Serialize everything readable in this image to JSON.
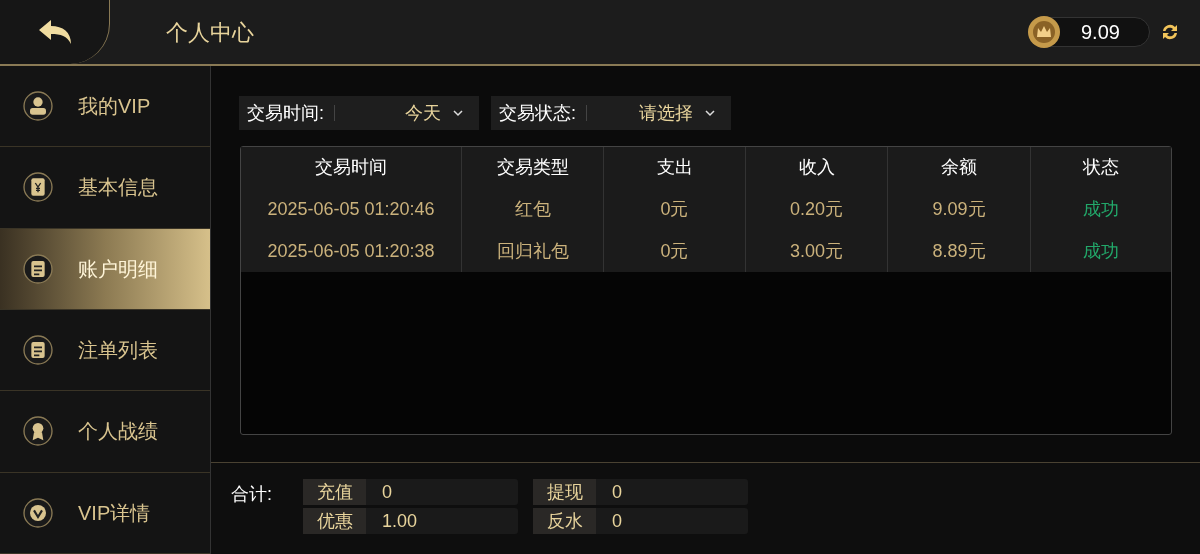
{
  "header": {
    "title": "个人中心",
    "balance": "9.09"
  },
  "sidebar": {
    "items": [
      {
        "label": "我的VIP",
        "selected": false
      },
      {
        "label": "基本信息",
        "selected": false
      },
      {
        "label": "账户明细",
        "selected": true
      },
      {
        "label": "注单列表",
        "selected": false
      },
      {
        "label": "个人战绩",
        "selected": false
      },
      {
        "label": "VIP详情",
        "selected": false
      }
    ]
  },
  "filters": [
    {
      "label": "交易时间:",
      "value": "今天"
    },
    {
      "label": "交易状态:",
      "value": "请选择"
    }
  ],
  "table": {
    "columns": [
      "交易时间",
      "交易类型",
      "支出",
      "收入",
      "余额",
      "状态"
    ],
    "rows": [
      {
        "cells": [
          "2025-06-05 01:20:46",
          "红包",
          "0元",
          "0.20元",
          "9.09元"
        ],
        "status": "成功",
        "kind": "success"
      },
      {
        "cells": [
          "2025-06-05 01:20:38",
          "回归礼包",
          "0元",
          "3.00元",
          "8.89元"
        ],
        "status": "成功",
        "kind": "success"
      }
    ]
  },
  "totals": {
    "label": "合计:",
    "items": [
      {
        "label": "充值",
        "value": "0"
      },
      {
        "label": "提现",
        "value": "0"
      },
      {
        "label": "优惠",
        "value": "1.00"
      },
      {
        "label": "反水",
        "value": "0"
      }
    ]
  }
}
